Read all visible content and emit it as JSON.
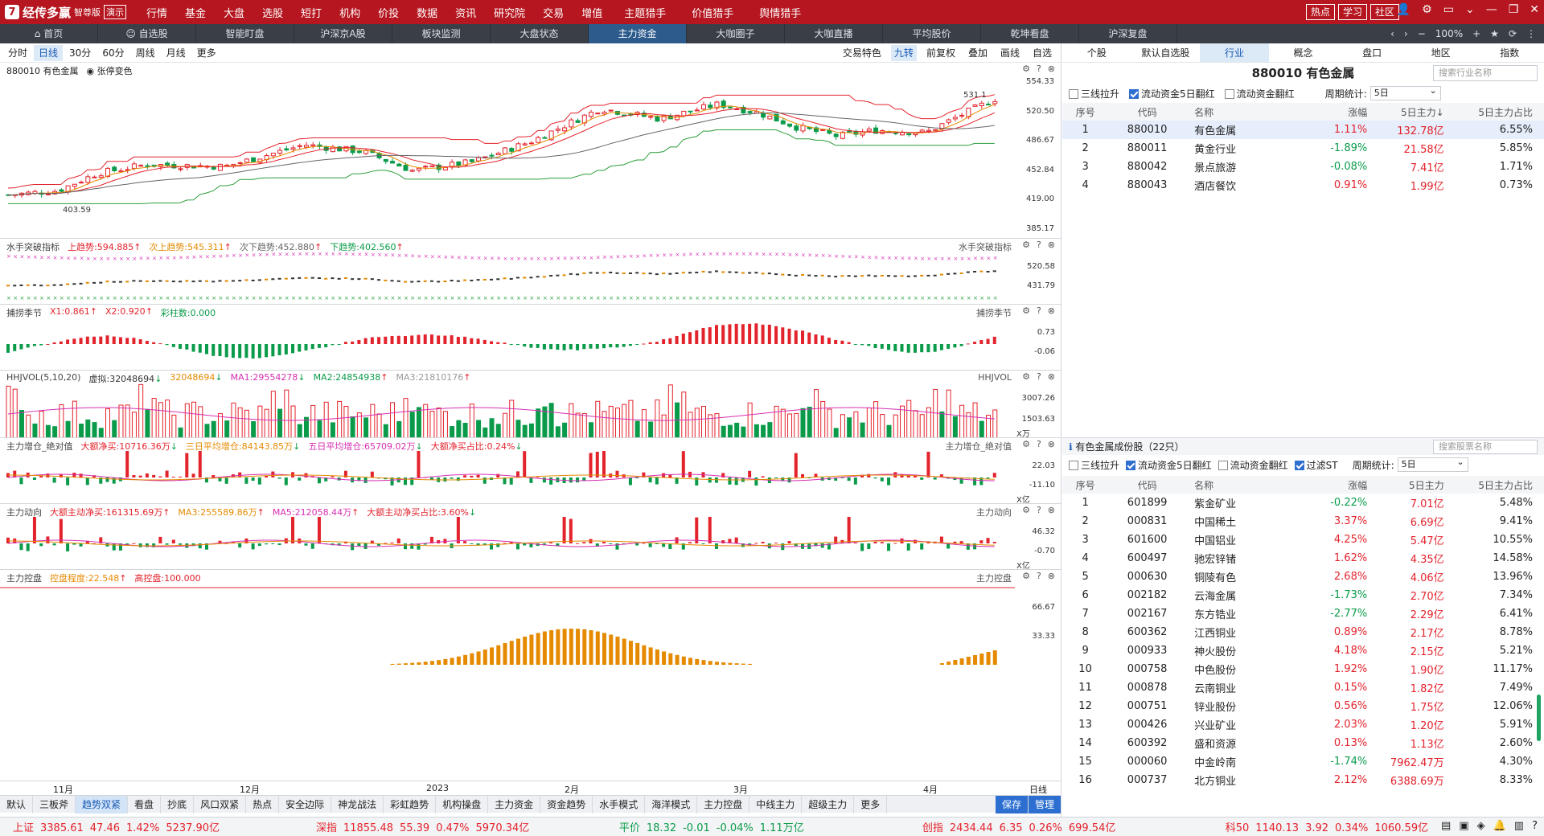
{
  "app": {
    "logo_glyph": "7",
    "name": "经传多赢",
    "edition": "智尊版",
    "demo": "演示"
  },
  "menu": [
    "行情",
    "基金",
    "大盘",
    "选股",
    "短打",
    "机构",
    "价投",
    "数据",
    "资讯",
    "研究院",
    "交易",
    "增值",
    "主题猎手",
    "价值猎手",
    "舆情猎手"
  ],
  "top_buttons": [
    "热点",
    "学习",
    "社区"
  ],
  "nav": {
    "items": [
      "首页",
      "自选股",
      "智能盯盘",
      "沪深京A股",
      "板块监测",
      "大盘状态",
      "主力资金",
      "大咖圈子",
      "大咖直播",
      "平均股价",
      "乾坤看盘",
      "沪深复盘"
    ],
    "active": 6,
    "zoom": "100%"
  },
  "chart_toolbar": {
    "periods": [
      "分时",
      "日线",
      "30分",
      "60分",
      "周线",
      "月线",
      "更多"
    ],
    "active": 1,
    "right": [
      "交易特色",
      "九转",
      "前复权",
      "叠加",
      "画线",
      "自选"
    ],
    "right_active": 1
  },
  "main_panel": {
    "title": "880010 有色金属",
    "mode": "张停变色",
    "y": [
      "554.33",
      "520.50",
      "486.67",
      "452.84",
      "419.00",
      "385.17"
    ],
    "low_label": "403.59",
    "high_label": "531.1"
  },
  "panels": [
    {
      "key": "p1",
      "name": "水手突破指标",
      "items": [
        {
          "t": "水手突破指标",
          "c": "#444"
        },
        {
          "t": "上趋势:594.885",
          "c": "#e3232c",
          "a": "up"
        },
        {
          "t": "次上趋势:545.311",
          "c": "#e58a00",
          "a": "up"
        },
        {
          "t": "次下趋势:452.880",
          "c": "#666",
          "a": "up"
        },
        {
          "t": "下趋势:402.560",
          "c": "#0a9b4a",
          "a": "up"
        }
      ],
      "y": [
        "520.58",
        "431.79"
      ]
    },
    {
      "key": "p2",
      "name": "捕捞季节",
      "items": [
        {
          "t": "捕捞季节",
          "c": "#444"
        },
        {
          "t": "X1:0.861",
          "c": "#e3232c",
          "a": "up"
        },
        {
          "t": "X2:0.920",
          "c": "#e3232c",
          "a": "up"
        },
        {
          "t": "彩柱数:0.000",
          "c": "#0a9b4a"
        }
      ],
      "y": [
        "0.73",
        "-0.06"
      ]
    },
    {
      "key": "p3",
      "name": "HHJVOL",
      "items": [
        {
          "t": "HHJVOL(5,10,20)",
          "c": "#444"
        },
        {
          "t": "虚拟:32048694",
          "c": "#333",
          "a": "dn"
        },
        {
          "t": "32048694",
          "c": "#e58a00",
          "a": "dn"
        },
        {
          "t": "MA1:29554278",
          "c": "#d62fb2",
          "a": "dn"
        },
        {
          "t": "MA2:24854938",
          "c": "#0a9b4a",
          "a": "up"
        },
        {
          "t": "MA3:21810176",
          "c": "#999",
          "a": "up"
        }
      ],
      "y": [
        "3007.26",
        "1503.63"
      ],
      "unit": "X万"
    },
    {
      "key": "p4",
      "name": "主力增仓_绝对值",
      "items": [
        {
          "t": "主力增仓_绝对值",
          "c": "#444"
        },
        {
          "t": "大额净买:10716.36万",
          "c": "#e3232c",
          "a": "dn"
        },
        {
          "t": "三日平均增仓:84143.85万",
          "c": "#e58a00",
          "a": "dn"
        },
        {
          "t": "五日平均增仓:65709.02万",
          "c": "#d62fb2",
          "a": "dn"
        },
        {
          "t": "大额净买占比:0.24%",
          "c": "#e3232c",
          "a": "dn"
        }
      ],
      "y": [
        "22.03",
        "-11.10"
      ],
      "unit": "X亿"
    },
    {
      "key": "p5",
      "name": "主力动向",
      "items": [
        {
          "t": "主力动向",
          "c": "#444"
        },
        {
          "t": "大额主动净买:161315.69万",
          "c": "#e3232c",
          "a": "up"
        },
        {
          "t": "MA3:255589.86万",
          "c": "#e58a00",
          "a": "up"
        },
        {
          "t": "MA5:212058.44万",
          "c": "#d62fb2",
          "a": "up"
        },
        {
          "t": "大额主动净买占比:3.60%",
          "c": "#e3232c",
          "a": "dn"
        }
      ],
      "y": [
        "46.32",
        "-0.70"
      ],
      "unit": "X亿"
    },
    {
      "key": "p6",
      "name": "主力控盘",
      "items": [
        {
          "t": "主力控盘",
          "c": "#444"
        },
        {
          "t": "控盘程度:22.548",
          "c": "#e58a00",
          "a": "up"
        },
        {
          "t": "高控盘:100.000",
          "c": "#e3232c"
        }
      ],
      "y": [
        "66.67",
        "33.33"
      ]
    }
  ],
  "xaxis": {
    "labels": [
      "11月",
      "12月",
      "2023",
      "2月",
      "3月",
      "4月"
    ],
    "right": "日线"
  },
  "bottom_tabs": [
    "默认",
    "三板斧",
    "趋势双紧",
    "看盘",
    "抄底",
    "风口双紧",
    "热点",
    "安全边际",
    "神龙战法",
    "彩虹趋势",
    "机构操盘",
    "主力资金",
    "资金趋势",
    "水手模式",
    "海洋模式",
    "主力控盘",
    "中线主力",
    "超级主力",
    "更多",
    "保存",
    "管理"
  ],
  "bottom_tabs_active": 2,
  "right": {
    "tabs": [
      "个股",
      "默认自选股",
      "行业",
      "概念",
      "盘口",
      "地区",
      "指数"
    ],
    "tabs_active": 2,
    "title": "880010  有色金属",
    "search_placeholder": "搜索行业名称",
    "filters": {
      "a": "三线拉升",
      "b": "流动资金5日翻红",
      "c": "流动资金翻红",
      "period_label": "周期统计:",
      "period": "5日",
      "st": "过滤ST"
    },
    "headers": [
      "序号",
      "代码",
      "名称",
      "涨幅",
      "5日主力↓",
      "5日主力占比"
    ],
    "industries": [
      [
        "1",
        "880010",
        "有色金属",
        "1.11%",
        "132.78亿",
        "6.55%"
      ],
      [
        "2",
        "880011",
        "黄金行业",
        "-1.89%",
        "21.58亿",
        "5.85%"
      ],
      [
        "3",
        "880042",
        "景点旅游",
        "-0.08%",
        "7.41亿",
        "1.71%"
      ],
      [
        "4",
        "880043",
        "酒店餐饮",
        "0.91%",
        "1.99亿",
        "0.73%"
      ]
    ],
    "stocks_title": "有色金属成份股（22只）",
    "stocks_search": "搜索股票名称",
    "stock_headers": [
      "序号",
      "代码",
      "名称",
      "涨幅",
      "5日主力",
      "5日主力占比"
    ],
    "stocks": [
      [
        "1",
        "601899",
        "紫金矿业",
        "-0.22%",
        "7.01亿",
        "5.48%"
      ],
      [
        "2",
        "000831",
        "中国稀土",
        "3.37%",
        "6.69亿",
        "9.41%"
      ],
      [
        "3",
        "601600",
        "中国铝业",
        "4.25%",
        "5.47亿",
        "10.55%"
      ],
      [
        "4",
        "600497",
        "驰宏锌锗",
        "1.62%",
        "4.35亿",
        "14.58%"
      ],
      [
        "5",
        "000630",
        "铜陵有色",
        "2.68%",
        "4.06亿",
        "13.96%"
      ],
      [
        "6",
        "002182",
        "云海金属",
        "-1.73%",
        "2.70亿",
        "7.34%"
      ],
      [
        "7",
        "002167",
        "东方锆业",
        "-2.77%",
        "2.29亿",
        "6.41%"
      ],
      [
        "8",
        "600362",
        "江西铜业",
        "0.89%",
        "2.17亿",
        "8.78%"
      ],
      [
        "9",
        "000933",
        "神火股份",
        "4.18%",
        "2.15亿",
        "5.21%"
      ],
      [
        "10",
        "000758",
        "中色股份",
        "1.92%",
        "1.90亿",
        "11.17%"
      ],
      [
        "11",
        "000878",
        "云南铜业",
        "0.15%",
        "1.82亿",
        "7.49%"
      ],
      [
        "12",
        "000751",
        "锌业股份",
        "0.56%",
        "1.75亿",
        "12.06%"
      ],
      [
        "13",
        "000426",
        "兴业矿业",
        "2.03%",
        "1.20亿",
        "5.91%"
      ],
      [
        "14",
        "600392",
        "盛和资源",
        "0.13%",
        "1.13亿",
        "2.60%"
      ],
      [
        "15",
        "000060",
        "中金岭南",
        "-1.74%",
        "7962.47万",
        "4.30%"
      ],
      [
        "16",
        "000737",
        "北方铜业",
        "2.12%",
        "6388.69万",
        "8.33%"
      ]
    ]
  },
  "status": [
    {
      "n": "上证",
      "v": "3385.61",
      "c": "47.46",
      "p": "1.42%",
      "a": "5237.90亿",
      "col": "#e3232c"
    },
    {
      "n": "深指",
      "v": "11855.48",
      "c": "55.39",
      "p": "0.47%",
      "a": "5970.34亿",
      "col": "#e3232c"
    },
    {
      "n": "平价",
      "v": "18.32",
      "c": "-0.01",
      "p": "-0.04%",
      "a": "1.11万亿",
      "col": "#0a9b4a"
    },
    {
      "n": "创指",
      "v": "2434.44",
      "c": "6.35",
      "p": "0.26%",
      "a": "699.54亿",
      "col": "#e3232c"
    },
    {
      "n": "科50",
      "v": "1140.13",
      "c": "3.92",
      "p": "0.34%",
      "a": "1060.59亿",
      "col": "#e3232c"
    }
  ],
  "colors": {
    "up": "#e3232c",
    "down": "#0a9b4a",
    "brand": "#b5161f"
  }
}
